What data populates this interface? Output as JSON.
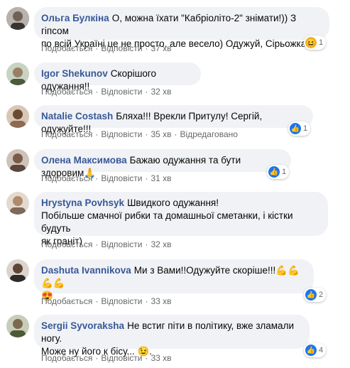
{
  "actions_labels": {
    "like": "Подобається",
    "reply": "Відповісти",
    "edited": "Відредаговано"
  },
  "comments": [
    {
      "author": "Ольга Булкіна",
      "text1": "О, можна їхати \"Кабріоліто-2\" знімати!)) З гіпсом",
      "text2": "по всій Україні це не просто, але весело) Одужуй, Сірьожка!",
      "time": "37 хв",
      "reaction": {
        "type": "haha",
        "count": "1"
      }
    },
    {
      "author": "Igor Shekunov",
      "text1": "Скорішого одужання!!",
      "time": "32 хв"
    },
    {
      "author": "Natalie Costash",
      "text1": "Бляха!!! Врекли Притулу! Сергій, одужуйте!!!",
      "time": "35 хв",
      "edited": true,
      "reaction": {
        "type": "like",
        "count": "1"
      }
    },
    {
      "author": "Олена Максимова",
      "text1": "Бажаю одужання та бути здоровим🙏",
      "time": "31 хв",
      "reaction": {
        "type": "like",
        "count": "1"
      }
    },
    {
      "author": "Hrystyna Povhsyk",
      "text1": "Швидкого одужання!",
      "text2": "Побільше смачної рибки та домашньої сметанки, і кістки будуть",
      "text3": "як граніт)",
      "time": "32 хв"
    },
    {
      "author": "Dashuta Ivannikova",
      "text1": "Ми з Вами!!Одужуйте скоріше!!!💪💪💪💪",
      "text2": "😍",
      "time": "33 хв",
      "reaction": {
        "type": "like",
        "count": "2"
      }
    },
    {
      "author": "Sergii Syvoraksha",
      "text1": "Не встиг піти в політику, вже зламали ногу.",
      "text2": "Може ну його к бісу... 😉.",
      "time": "33 хв",
      "reaction": {
        "type": "like",
        "count": "4"
      }
    }
  ],
  "colors": {
    "author": "#385898",
    "bubble": "#f0f2f5",
    "meta": "#65676b",
    "like": "#1877f2"
  }
}
